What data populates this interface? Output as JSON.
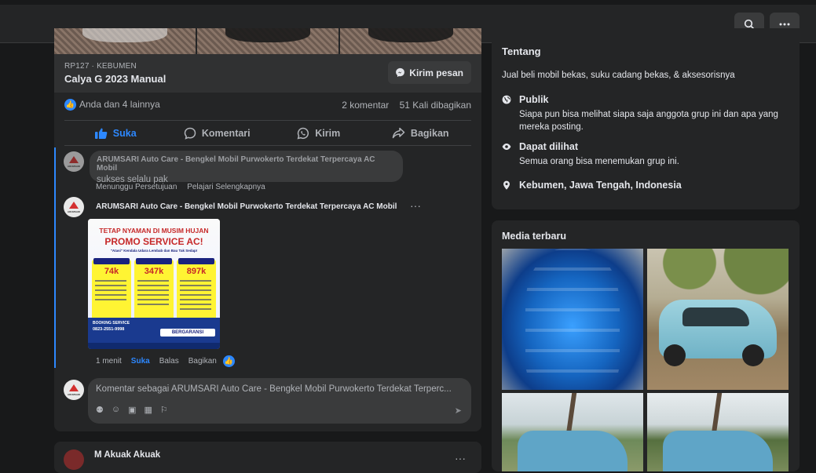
{
  "topbar": {
    "search_icon": "search-icon",
    "more_icon": "more-icon"
  },
  "post": {
    "listing_meta": "RP127 · KEBUMEN",
    "listing_title": "Calya G 2023 Manual",
    "message_button": "Kirim pesan",
    "reactions_text": "Anda dan 4 lainnya",
    "comments_count": "2 komentar",
    "shares_count": "51 Kali dibagikan",
    "actions": {
      "like": "Suka",
      "comment": "Komentari",
      "send": "Kirim",
      "share": "Bagikan"
    },
    "comment1": {
      "author": "ARUMSARI Auto Care - Bengkel Mobil Purwokerto Terdekat Terpercaya AC Mobil",
      "text": "sukses selalu pak",
      "pending": "Menunggu Persetujuan",
      "learn_more": "Pelajari Selengkapnya"
    },
    "comment2": {
      "author": "ARUMSARI Auto Care - Bengkel Mobil Purwokerto Terdekat Terpercaya AC Mobil",
      "time": "1 menit",
      "like": "Suka",
      "reply": "Balas",
      "share": "Bagikan",
      "promo": {
        "headline1": "TETAP NYAMAN DI MUSIM HUJAN",
        "headline2": "PROMO SERVICE AC!",
        "sub": "\"Atasi\" Kendala Udara Lembab dan Bau Tak Sedap!",
        "prices": [
          "74k",
          "347k",
          "897k"
        ],
        "booking": "BOOKING SERVICE",
        "phone": "0823-2551-9998",
        "guarantee": "BERGARANSI"
      }
    },
    "composer": {
      "placeholder": "Komentar sebagai ARUMSARI Auto Care - Bengkel Mobil Purwokerto Terdekat Terperc..."
    }
  },
  "next_post": {
    "author": "M Akuak Akuak"
  },
  "about": {
    "title": "Tentang",
    "description": "Jual beli mobil bekas, suku cadang bekas, & aksesorisnya",
    "public_title": "Publik",
    "public_desc": "Siapa pun bisa melihat siapa saja anggota grup ini dan apa yang mereka posting.",
    "visible_title": "Dapat dilihat",
    "visible_desc": "Semua orang bisa menemukan grup ini.",
    "location": "Kebumen, Jawa Tengah, Indonesia"
  },
  "media": {
    "title": "Media terbaru"
  }
}
